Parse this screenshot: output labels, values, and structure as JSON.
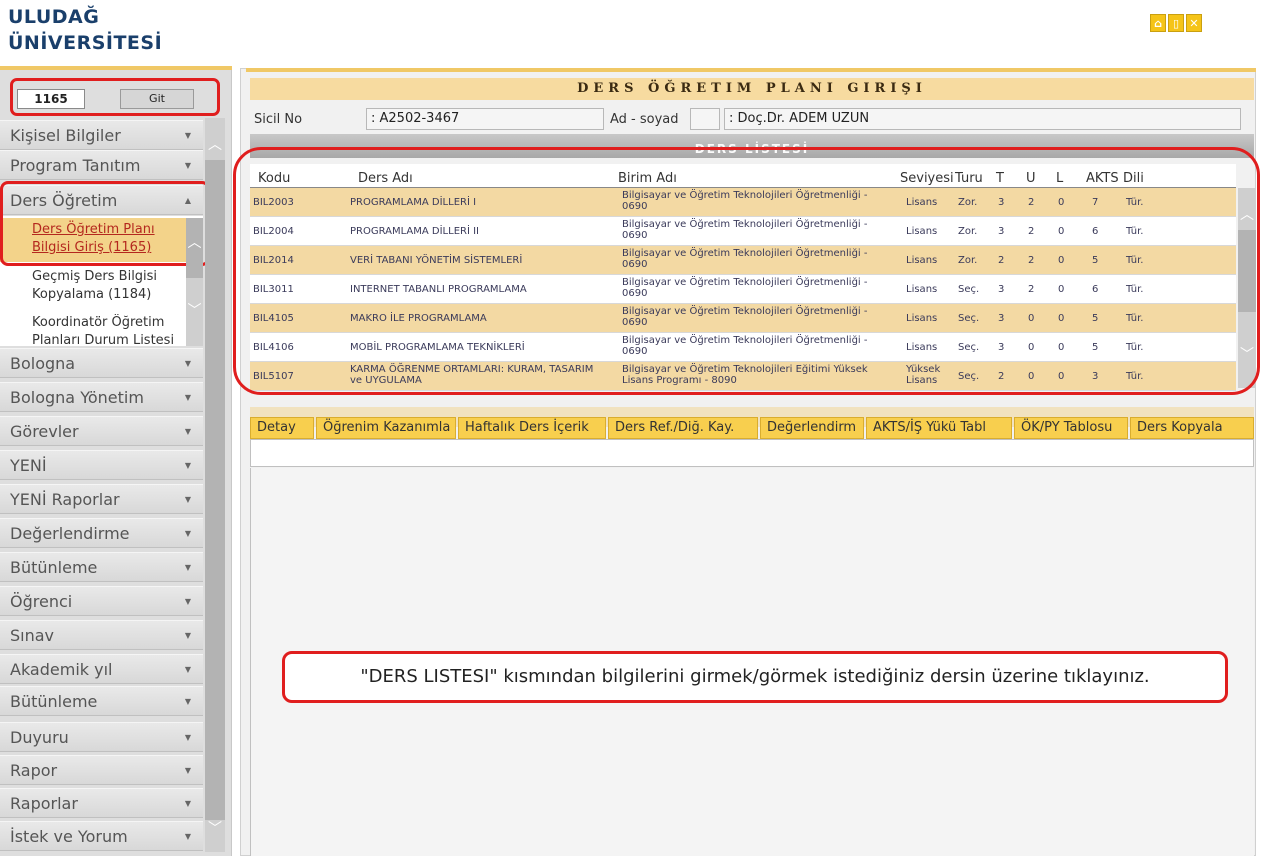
{
  "brand": {
    "line1": "ULUDAĞ",
    "line2": "ÜNİVERSİTESİ"
  },
  "top_icons": [
    "home-icon",
    "document-icon",
    "close-icon"
  ],
  "sicil_input": {
    "value": "1165"
  },
  "git_button": "Git",
  "sidebar": {
    "items": [
      "Kişisel Bilgiler",
      "Program Tanıtım",
      "Ders Öğretim",
      "Bologna",
      "Bologna Yönetim",
      "Görevler",
      "YENİ",
      "YENİ Raporlar",
      "Değerlendirme",
      "Bütünleme",
      "Öğrenci",
      "Sınav",
      "Akademik yıl",
      "Bütünleme",
      "Duyuru",
      "Rapor",
      "Raporlar",
      "İstek ve Yorum"
    ],
    "submenu": [
      {
        "line1": "Ders Öğretim Planı",
        "line2": "Bilgisi Giriş (1165)"
      },
      {
        "line1": "Geçmiş Ders Bilgisi",
        "line2": "Kopyalama (1184)"
      },
      {
        "line1": "Koordinatör Öğretim",
        "line2": "Planları Durum Listesi"
      }
    ]
  },
  "main": {
    "title": "DERS ÖĞRETIM PLANI GIRIŞI",
    "sicil_label": "Sicil No",
    "sicil_value": ": A2502-3467",
    "ad_label": "Ad - soyad",
    "ad_value": ": Doç.Dr. ADEM UZUN",
    "liste_title": "DERS LİSTESİ"
  },
  "table": {
    "headers": [
      "Kodu",
      "Ders Adı",
      "Birim Adı",
      "Seviyesi",
      "Turu",
      "T",
      "U",
      "L",
      "AKTS",
      "Dili"
    ],
    "rows": [
      {
        "kodu": "BIL2003",
        "ders": "PROGRAMLAMA DİLLERİ I",
        "birim1": "Bilgisayar ve Öğretim Teknolojileri Öğretmenliği -",
        "birim2": "0690",
        "seviye1": "Lisans",
        "seviye2": "",
        "turu": "Zor.",
        "t": "3",
        "u": "2",
        "l": "0",
        "akts": "7",
        "dili": "Tür."
      },
      {
        "kodu": "BIL2004",
        "ders": "PROGRAMLAMA DİLLERİ II",
        "birim1": "Bilgisayar ve Öğretim Teknolojileri Öğretmenliği -",
        "birim2": "0690",
        "seviye1": "Lisans",
        "seviye2": "",
        "turu": "Zor.",
        "t": "3",
        "u": "2",
        "l": "0",
        "akts": "6",
        "dili": "Tür."
      },
      {
        "kodu": "BIL2014",
        "ders": "VERİ TABANI YÖNETİM SİSTEMLERİ",
        "birim1": "Bilgisayar ve Öğretim Teknolojileri Öğretmenliği -",
        "birim2": "0690",
        "seviye1": "Lisans",
        "seviye2": "",
        "turu": "Zor.",
        "t": "2",
        "u": "2",
        "l": "0",
        "akts": "5",
        "dili": "Tür."
      },
      {
        "kodu": "BIL3011",
        "ders": "INTERNET TABANLI PROGRAMLAMA",
        "birim1": "Bilgisayar ve Öğretim Teknolojileri Öğretmenliği -",
        "birim2": "0690",
        "seviye1": "Lisans",
        "seviye2": "",
        "turu": "Seç.",
        "t": "3",
        "u": "2",
        "l": "0",
        "akts": "6",
        "dili": "Tür."
      },
      {
        "kodu": "BIL4105",
        "ders": "MAKRO İLE PROGRAMLAMA",
        "birim1": "Bilgisayar ve Öğretim Teknolojileri Öğretmenliği -",
        "birim2": "0690",
        "seviye1": "Lisans",
        "seviye2": "",
        "turu": "Seç.",
        "t": "3",
        "u": "0",
        "l": "0",
        "akts": "5",
        "dili": "Tür."
      },
      {
        "kodu": "BIL4106",
        "ders": "MOBİL PROGRAMLAMA TEKNİKLERİ",
        "birim1": "Bilgisayar ve Öğretim Teknolojileri Öğretmenliği -",
        "birim2": "0690",
        "seviye1": "Lisans",
        "seviye2": "",
        "turu": "Seç.",
        "t": "3",
        "u": "0",
        "l": "0",
        "akts": "5",
        "dili": "Tür."
      },
      {
        "kodu": "BIL5107",
        "ders": "KARMA ÖĞRENME ORTAMLARI: KURAM, TASARIM ve UYGULAMA",
        "birim1": "Bilgisayar ve Öğretim Teknolojileri Eğitimi Yüksek",
        "birim2": "Lisans Programı - 8090",
        "seviye1": "Yüksek",
        "seviye2": "Lisans",
        "turu": "Seç.",
        "t": "2",
        "u": "0",
        "l": "0",
        "akts": "3",
        "dili": "Tür."
      }
    ]
  },
  "tabs": [
    "Detay",
    "Öğrenim Kazanımla",
    "Haftalık Ders İçerik",
    "Ders Ref./Diğ. Kay.",
    "Değerlendirm",
    "AKTS/İŞ Yükü Tabl",
    "ÖK/PY Tablosu",
    "Ders Kopyala"
  ],
  "hint": "\"DERS LISTESI\" kısmından bilgilerini girmek/görmek istediğiniz dersin üzerine  tıklayınız.",
  "colors": {
    "accent_red": "#e01e1e",
    "row_alt": "#f3d9a3",
    "tab": "#f8cf4e",
    "brand": "#1a3f6b"
  }
}
